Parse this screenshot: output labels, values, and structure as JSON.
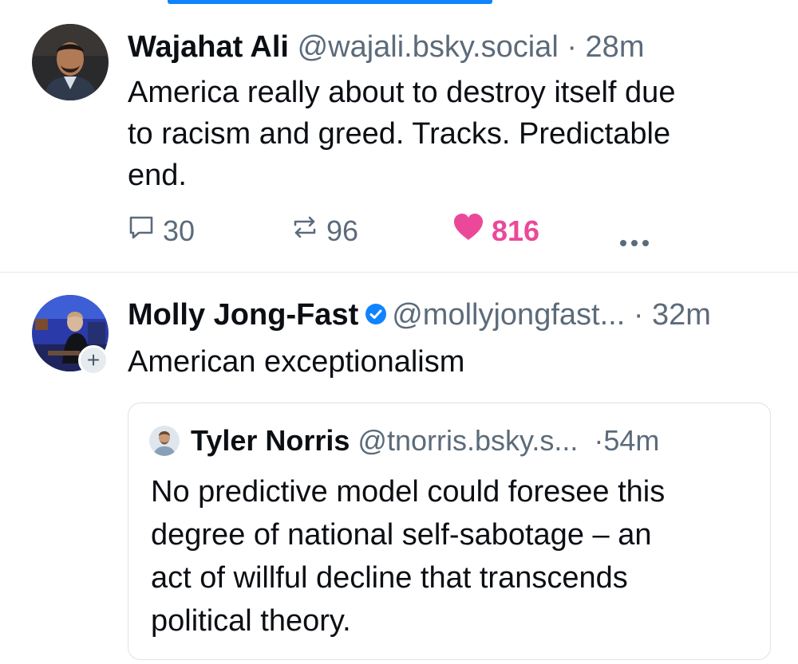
{
  "post1": {
    "author_name": "Wajahat Ali",
    "handle": "@wajali.bsky.social",
    "separator": "·",
    "time": "28m",
    "text_line1": "America really about to destroy itself due",
    "text_line2": "to racism and greed. Tracks. Predictable",
    "text_line3": "end.",
    "replies": "30",
    "reposts": "96",
    "likes": "816"
  },
  "post2": {
    "author_name": "Molly Jong-Fast",
    "handle": "@mollyjongfast...",
    "separator": "·",
    "time": "32m",
    "follow_symbol": "+",
    "text": "American exceptionalism",
    "quote": {
      "author_name": "Tyler Norris",
      "handle": "@tnorris.bsky.s...",
      "separator": "·",
      "time": "54m",
      "text_line1": "No predictive model could foresee this",
      "text_line2": "degree of national self-sabotage – an",
      "text_line3": "act of willful decline that transcends",
      "text_line4": "political theory."
    }
  },
  "colors": {
    "accent": "#1083fe",
    "like": "#ec4899",
    "muted": "#5c6b7a",
    "divider": "#e3e7ec"
  },
  "icons": [
    "reply-icon",
    "repost-icon",
    "heart-icon",
    "more-icon",
    "verified-icon",
    "plus-icon"
  ]
}
